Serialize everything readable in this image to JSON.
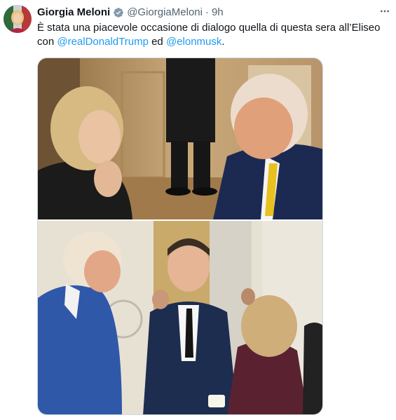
{
  "tweet": {
    "display_name": "Giorgia Meloni",
    "handle": "@GiorgiaMeloni",
    "separator": "·",
    "time": "9h",
    "more_label": "•••",
    "text_part1": "È stata una piacevole occasione di dialogo quella di questa sera all’Eliseo con ",
    "mention1": "@realDonaldTrump",
    "text_part2": " ed ",
    "mention2": "@elonmusk",
    "text_part3": "."
  },
  "icons": {
    "verified": "verified-badge-icon",
    "more": "more-options-icon"
  },
  "colors": {
    "link": "#1d9bf0",
    "secondary_text": "#536471",
    "primary_text": "#0f1419",
    "verified": "#829aab"
  }
}
